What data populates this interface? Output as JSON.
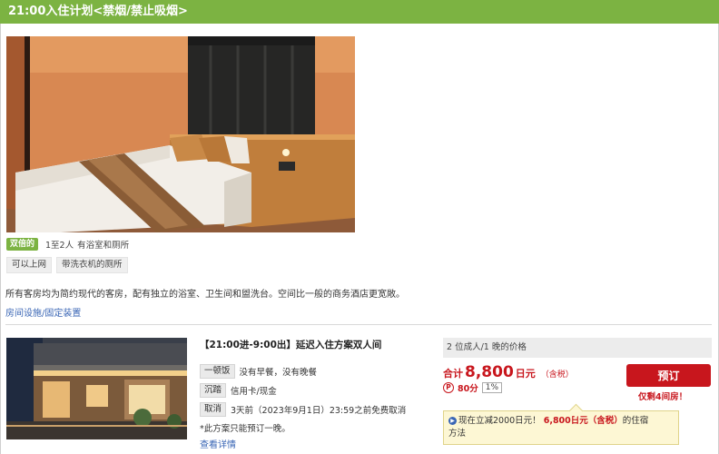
{
  "header": {
    "title": "21:00入住计划<禁烟/禁止吸烟>"
  },
  "room": {
    "type_badge": "双倍的",
    "capacity": "1至2人",
    "bath": "有浴室和厕所",
    "chips": [
      "可以上网",
      "带洗衣机的厕所"
    ],
    "description": "所有客房均为简约现代的客房，配有独立的浴室、卫生间和盥洗台。空间比一般的商务酒店更宽敞。",
    "facilities_link": "房间设施/固定装置"
  },
  "plan": {
    "title": "【21:00进-9:00出】延迟入住方案双人间",
    "meals_label": "一顿饭",
    "meals_text": "没有早餐，没有晚餐",
    "payment_label": "沉踏",
    "payment_text": "信用卡/现金",
    "cancel_label": "取消",
    "cancel_text": "3天前（2023年9月1日）23:59之前免费取消",
    "note": "*此方案只能预订一晚。",
    "details_link": "查看详情"
  },
  "price": {
    "header": "2 位成人/1 晚的价格",
    "prefix": "合计",
    "amount": "8,800",
    "unit": "日元",
    "tax": "（含税）",
    "points_icon": "P",
    "points": "80分",
    "points_rate": "1%",
    "book_label": "预订",
    "rooms_left": "仅剩4间房！",
    "promo_prefix": "现在立减2000日元！",
    "promo_amount": "6,800日元（含税）",
    "promo_suffix": "的住宿",
    "promo_line2": "方法"
  },
  "colors": {
    "header_green": "#7cb342",
    "accent_red": "#c8161d",
    "link_blue": "#3a66b5"
  }
}
